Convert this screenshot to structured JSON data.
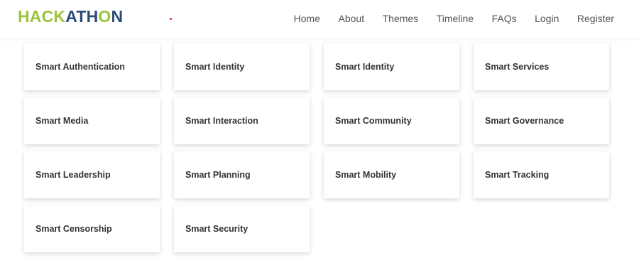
{
  "logo": {
    "part1": "HACK",
    "part2": "ATH",
    "part3": "O",
    "part4": "N",
    "colors": {
      "green": "#9cc33b",
      "navy": "#2a4a7a"
    }
  },
  "nav": {
    "items": [
      "Home",
      "About",
      "Themes",
      "Timeline",
      "FAQs",
      "Login",
      "Register"
    ]
  },
  "themes": [
    "Smart Authentication",
    "Smart Identity",
    "Smart Identity",
    "Smart Services",
    "Smart Media",
    "Smart Interaction",
    "Smart Community",
    "Smart Governance",
    "Smart Leadership",
    "Smart Planning",
    "Smart Mobility",
    "Smart Tracking",
    "Smart Censorship",
    "Smart Security"
  ]
}
